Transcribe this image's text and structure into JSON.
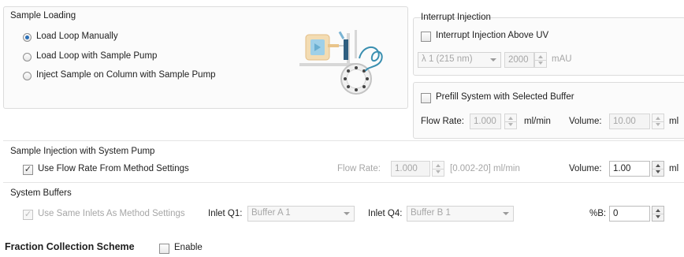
{
  "sample_loading": {
    "title": "Sample Loading",
    "options": [
      {
        "label": "Load Loop Manually",
        "selected": true
      },
      {
        "label": "Load Loop with Sample Pump",
        "selected": false
      },
      {
        "label": "Inject Sample on Column with Sample Pump",
        "selected": false
      }
    ]
  },
  "interrupt_injection": {
    "title": "Interrupt Injection",
    "checkbox_label": "Interrupt Injection Above UV",
    "checked": false,
    "uv_channel": "λ 1 (215 nm)",
    "threshold": "2000",
    "unit": "mAU"
  },
  "prefill": {
    "checkbox_label": "Prefill System with Selected Buffer",
    "checked": false,
    "flow_rate_label": "Flow Rate:",
    "flow_rate": "1.000",
    "flow_unit": "ml/min",
    "volume_label": "Volume:",
    "volume": "10.00",
    "volume_unit": "ml"
  },
  "system_pump": {
    "title": "Sample Injection with System Pump",
    "checkbox_label": "Use Flow Rate From Method Settings",
    "checked": true,
    "flow_rate_label": "Flow Rate:",
    "flow_rate": "1.000",
    "flow_range": "[0.002-20] ml/min",
    "volume_label": "Volume:",
    "volume": "1.00",
    "volume_unit": "ml"
  },
  "system_buffers": {
    "title": "System Buffers",
    "checkbox_label": "Use Same Inlets As Method Settings",
    "checked": true,
    "inlet_q1_label": "Inlet Q1:",
    "inlet_q1": "Buffer A 1",
    "inlet_q4_label": "Inlet Q4:",
    "inlet_q4": "Buffer B 1",
    "percent_b_label": "%B:",
    "percent_b": "0"
  },
  "fraction": {
    "title": "Fraction Collection Scheme",
    "enable_label": "Enable",
    "enabled": false
  },
  "icons": {
    "loading_diagram": "loop-valve-diagram-icon"
  },
  "colors": {
    "accent": "#2a6fb6",
    "coil": "#3a8fb0",
    "syringe": "#e9c48a"
  }
}
